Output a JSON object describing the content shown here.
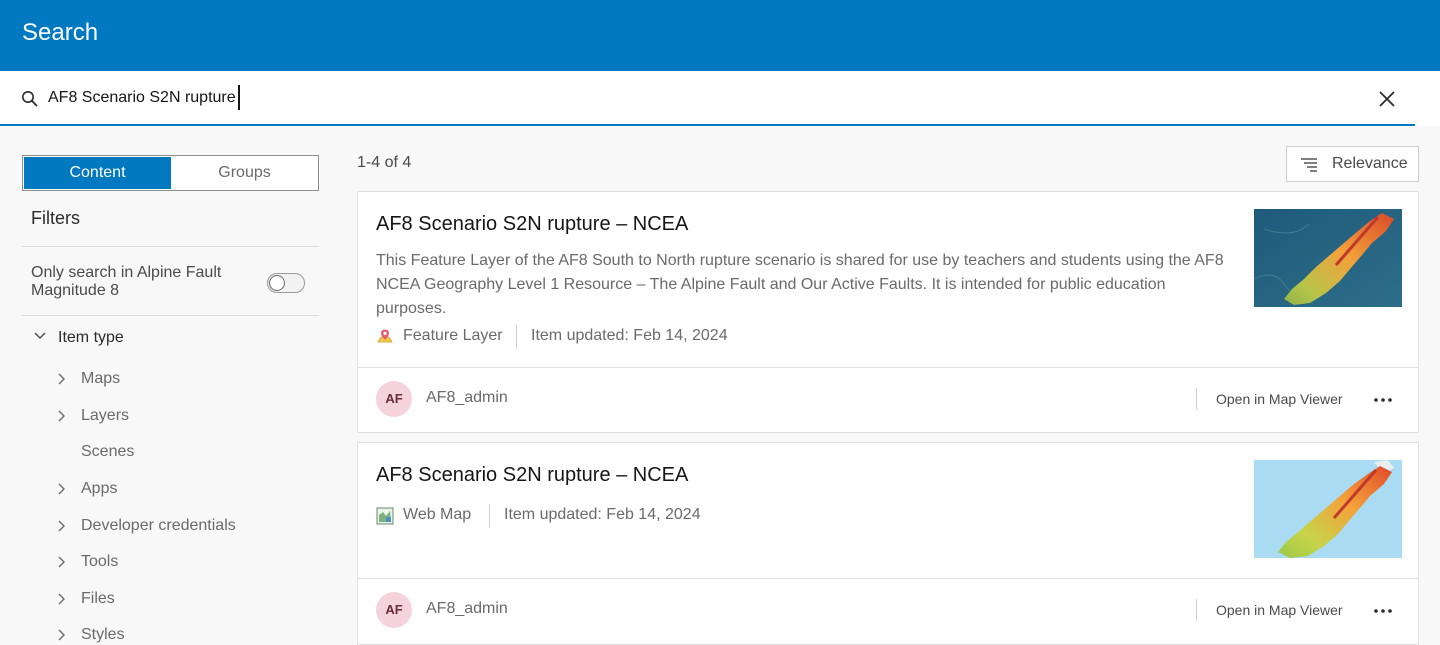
{
  "header": {
    "title": "Search"
  },
  "search": {
    "query": "AF8 Scenario S2N rupture",
    "icon": "search-icon",
    "clear_icon": "close-icon"
  },
  "sidebar": {
    "tabs": [
      {
        "label": "Content",
        "selected": true
      },
      {
        "label": "Groups",
        "selected": false
      }
    ],
    "filters_title": "Filters",
    "only_search_label": "Only search in Alpine Fault Magnitude 8",
    "only_search_enabled": false,
    "item_type": {
      "label": "Item type",
      "items": [
        {
          "label": "Maps",
          "expandable": true
        },
        {
          "label": "Layers",
          "expandable": true
        },
        {
          "label": "Scenes",
          "expandable": false
        },
        {
          "label": "Apps",
          "expandable": true
        },
        {
          "label": "Developer credentials",
          "expandable": true
        },
        {
          "label": "Tools",
          "expandable": true
        },
        {
          "label": "Files",
          "expandable": true
        },
        {
          "label": "Styles",
          "expandable": true
        }
      ]
    }
  },
  "results": {
    "count_text": "1-4 of 4",
    "sort_label": "Relevance",
    "items": [
      {
        "title": "AF8 Scenario S2N rupture – NCEA",
        "description": "This Feature Layer of the AF8 South to North rupture scenario is shared for use by teachers and students using the AF8 NCEA Geography Level 1 Resource – The Alpine Fault and Our Active Faults. It is intended for public education purposes.",
        "type": "Feature Layer",
        "type_icon": "feature-layer-icon",
        "updated": "Item updated: Feb 14, 2024",
        "owner_initials": "AF",
        "owner": "AF8_admin",
        "action": "Open in Map Viewer"
      },
      {
        "title": "AF8 Scenario S2N rupture – NCEA",
        "description": "",
        "type": "Web Map",
        "type_icon": "web-map-icon",
        "updated": "Item updated: Feb 14, 2024",
        "owner_initials": "AF",
        "owner": "AF8_admin",
        "action": "Open in Map Viewer"
      }
    ]
  },
  "colors": {
    "brand": "#0079c1",
    "avatar_bg": "#f5d3dc"
  }
}
